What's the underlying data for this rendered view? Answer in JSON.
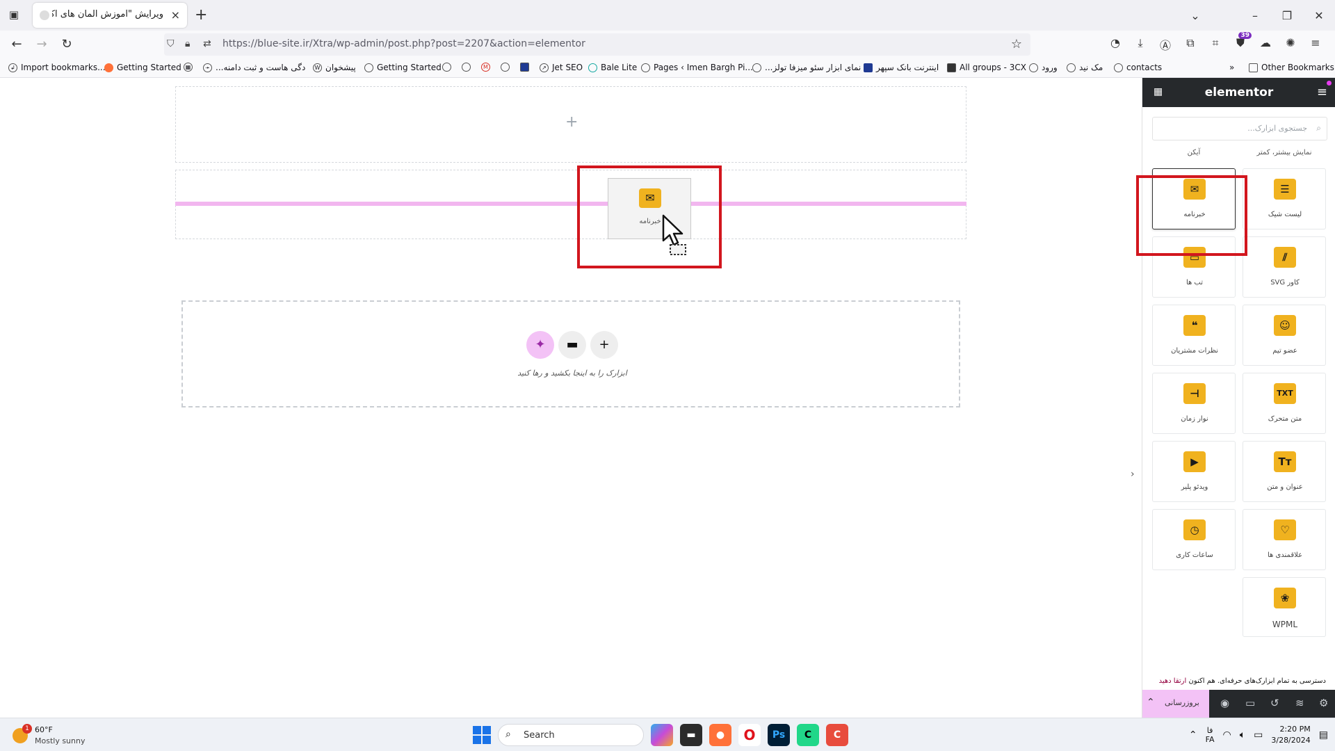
{
  "browser": {
    "tab_title": "ویرایش \"آموزش المان های اکسترا - ",
    "url": "https://blue-site.ir/Xtra/wp-admin/post.php?post=2207&action=elementor",
    "bookmarks": [
      "Import bookmarks...",
      "Getting Started",
      "...دگی هاست و ثبت دامنه",
      "پیشخوان",
      "Getting Started",
      "Jet SEO",
      "Bale Lite",
      "Pages ‹ Imen Bargh Pi...",
      "...نمای ابزار سئو میزفا تولز",
      "اینترنت بانک سپهر",
      "All groups - 3CX",
      "ورود",
      "مک نید",
      "contacts",
      "Other Bookmarks"
    ],
    "extension_badge": "39"
  },
  "canvas": {
    "drag_widget_label": "خبرنامه",
    "drop_hint": "ابزارک را به اینجا بکشید و رها کنید"
  },
  "panel": {
    "logo": "elementor",
    "search_placeholder": "جستجوی ابزارک...",
    "cut_labels": [
      "آیکن",
      "نمایش بیشتر، کمتر"
    ],
    "widgets": [
      {
        "label": "خبرنامه",
        "icon": "envelope-icon",
        "glyph": "✉"
      },
      {
        "label": "لیست شیک",
        "icon": "list-icon",
        "glyph": "☰"
      },
      {
        "label": "تب ها",
        "icon": "folder-icon",
        "glyph": "▭"
      },
      {
        "label": "کاور SVG",
        "icon": "svg-cover-icon",
        "glyph": "⫽"
      },
      {
        "label": "نظرات مشتریان",
        "icon": "quote-icon",
        "glyph": "❝"
      },
      {
        "label": "عضو تیم",
        "icon": "team-icon",
        "glyph": "☺"
      },
      {
        "label": "نوار زمان",
        "icon": "timeline-icon",
        "glyph": "⊣"
      },
      {
        "label": "متن متحرک",
        "icon": "animated-text-icon",
        "glyph": "TXT"
      },
      {
        "label": "ویدئو پلیر",
        "icon": "video-player-icon",
        "glyph": "▶"
      },
      {
        "label": "عنوان و متن",
        "icon": "heading-text-icon",
        "glyph": "Tт"
      },
      {
        "label": "ساعات کاری",
        "icon": "clock-icon",
        "glyph": "◷"
      },
      {
        "label": "علاقمندی ها",
        "icon": "heart-icon",
        "glyph": "♡"
      },
      {
        "label": "WPML",
        "icon": "wpml-icon",
        "glyph": "❀"
      }
    ],
    "promo_text": "دسترسی به تمام ابزارک‌های حرفه‌ای. هم اکنون",
    "promo_link": "ارتقا دهید",
    "update_label": "بروزرسانی"
  },
  "taskbar": {
    "temp": "60°F",
    "weather": "Mostly sunny",
    "weather_badge": "1",
    "search_label": "Search",
    "lang_top": "فا",
    "lang_bottom": "FA",
    "time": "2:20 PM",
    "date": "3/28/2024"
  },
  "colors": {
    "elementor_dark": "#26292c",
    "widget_icon_bg": "#f0b21f",
    "highlight_red": "#d2161e",
    "drop_line_pink": "#f2b6ef"
  }
}
